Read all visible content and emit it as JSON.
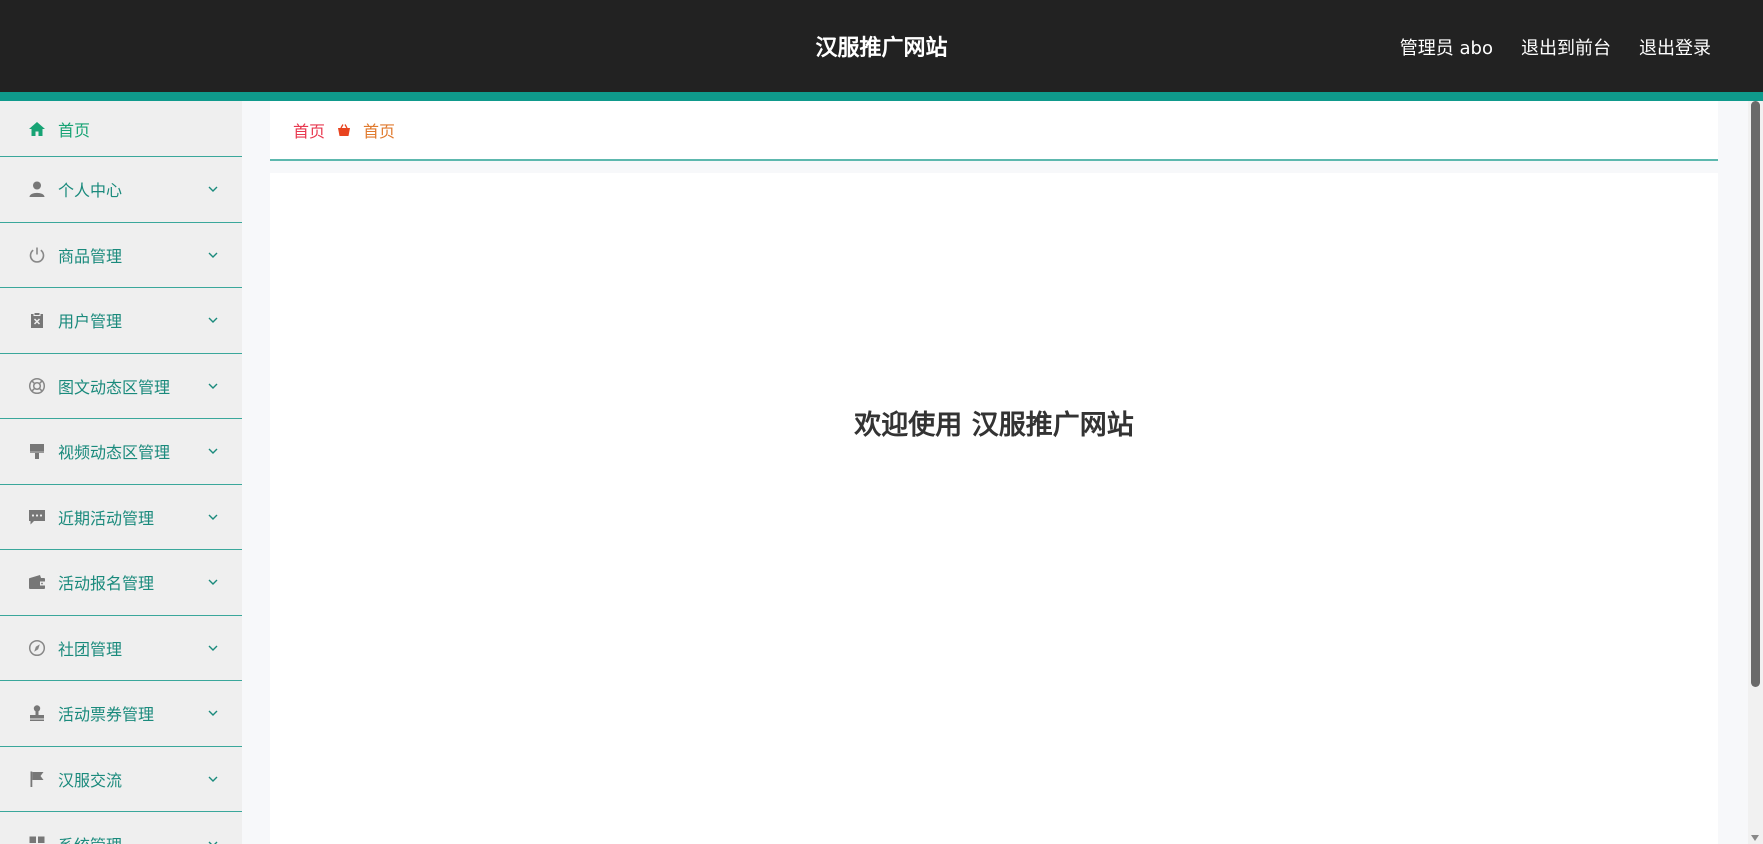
{
  "header": {
    "title": "汉服推广网站",
    "admin_label": "管理员 abo",
    "exit_front_label": "退出到前台",
    "logout_label": "退出登录"
  },
  "sidebar": {
    "items": [
      {
        "label": "首页",
        "icon": "home-icon"
      },
      {
        "label": "个人中心",
        "icon": "user-icon"
      },
      {
        "label": "商品管理",
        "icon": "power-icon"
      },
      {
        "label": "用户管理",
        "icon": "clipboard-icon"
      },
      {
        "label": "图文动态区管理",
        "icon": "lifebuoy-icon"
      },
      {
        "label": "视频动态区管理",
        "icon": "brush-icon"
      },
      {
        "label": "近期活动管理",
        "icon": "chat-icon"
      },
      {
        "label": "活动报名管理",
        "icon": "wallet-icon"
      },
      {
        "label": "社团管理",
        "icon": "compass-icon"
      },
      {
        "label": "活动票券管理",
        "icon": "stamp-icon"
      },
      {
        "label": "汉服交流",
        "icon": "flag-icon"
      },
      {
        "label": "系统管理",
        "icon": "grid-icon"
      }
    ]
  },
  "breadcrumb": {
    "home": "首页",
    "current": "首页"
  },
  "main": {
    "welcome": "欢迎使用 汉服推广网站"
  },
  "colors": {
    "topbar": "#222222",
    "accent": "#0f9a8c",
    "menu_text": "#1a8a7c",
    "crumb_home": "#e8384f",
    "crumb_current": "#e07a2e"
  }
}
